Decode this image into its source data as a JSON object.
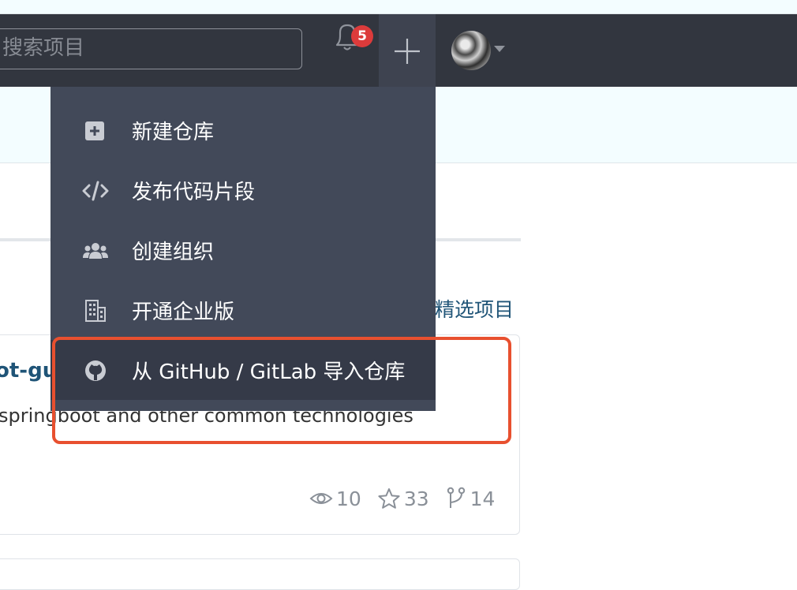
{
  "header": {
    "search_placeholder": "搜索项目",
    "notifications_count": "5"
  },
  "create_menu": {
    "items": [
      {
        "icon": "plus-square-icon",
        "label": "新建仓库"
      },
      {
        "icon": "code-icon",
        "label": "发布代码片段"
      },
      {
        "icon": "users-icon",
        "label": "创建组织"
      },
      {
        "icon": "building-icon",
        "label": "开通企业版"
      },
      {
        "icon": "github-icon",
        "label": "从 GitHub / GitLab 导入仓库"
      }
    ]
  },
  "main": {
    "featured_link": "精选项目",
    "repo": {
      "title": "ot-gu",
      "description": "springboot and other common technologies",
      "watchers": "10",
      "stars": "33",
      "forks": "14"
    }
  },
  "colors": {
    "navbar": "#32363f",
    "dropdown": "#424959",
    "highlight": "#e8502f",
    "link": "#1f5477"
  }
}
